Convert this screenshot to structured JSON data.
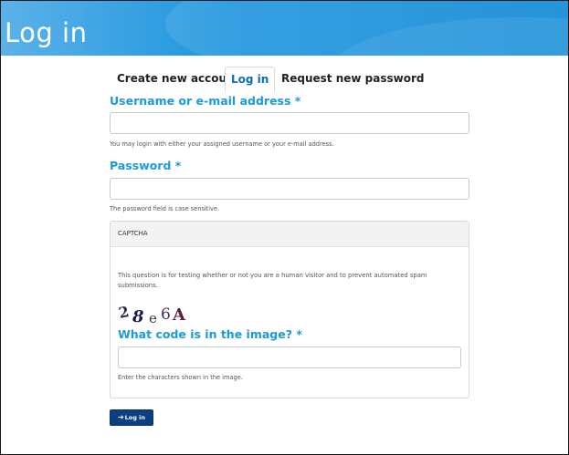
{
  "page": {
    "title": "Log in"
  },
  "tabs": [
    {
      "label": "Create new account",
      "active": false
    },
    {
      "label": "Log in",
      "active": true
    },
    {
      "label": "Request new password",
      "active": false
    }
  ],
  "form": {
    "username": {
      "label": "Username or e-mail address *",
      "value": "",
      "help": "You may login with either your assigned username or your e-mail address."
    },
    "password": {
      "label": "Password *",
      "value": "",
      "help": "The password field is case sensitive."
    },
    "captcha": {
      "heading": "CAPTCHA",
      "description": "This question is for testing whether or not you are a human visitor and to prevent automated spam submissions.",
      "image_text": "28e6A",
      "question_label": "What code is in the image? *",
      "answer_value": "",
      "answer_help": "Enter the characters shown in the image."
    },
    "submit_label": "Log in",
    "submit_icon": "sign-in-icon"
  },
  "colors": {
    "banner": "#1e95de",
    "label_blue": "#1a9bdc",
    "button": "#0b3f83"
  }
}
